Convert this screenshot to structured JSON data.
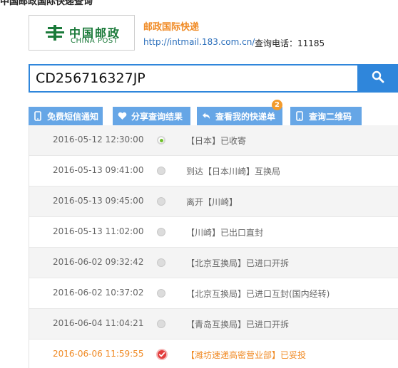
{
  "page": {
    "title": "中国邮政国际快递查询"
  },
  "brand": {
    "logo_cn": "中国邮政",
    "logo_en": "CHINA POST",
    "name": "邮政国际快递",
    "url": "http://intmail.183.com.cn/",
    "phone_label": "查询电话：11185"
  },
  "search": {
    "value": "CD256716327JP"
  },
  "actions": [
    {
      "label": "免费短信通知",
      "icon": "phone-icon"
    },
    {
      "label": "分享查询结果",
      "icon": "heart-icon"
    },
    {
      "label": "查看我的快递单",
      "icon": "back-arrow-icon",
      "badge": "2"
    },
    {
      "label": "查询二维码",
      "icon": "phone-icon"
    }
  ],
  "events": [
    {
      "time": "2016-05-12 12:30:00",
      "desc": "【日本】已收寄",
      "status": "start"
    },
    {
      "time": "2016-05-13 09:41:00",
      "desc": "到达【日本川崎】互换局",
      "status": "normal"
    },
    {
      "time": "2016-05-13 09:45:00",
      "desc": "离开【川崎】",
      "status": "normal"
    },
    {
      "time": "2016-05-13 11:02:00",
      "desc": "【川崎】已出口直封",
      "status": "normal"
    },
    {
      "time": "2016-06-02 09:32:42",
      "desc": "【北京互换局】已进口开拆",
      "status": "normal"
    },
    {
      "time": "2016-06-02 10:37:02",
      "desc": "【北京互换局】已进口互封(国内经转)",
      "status": "normal"
    },
    {
      "time": "2016-06-04 11:04:21",
      "desc": "【青岛互换局】已进口开拆",
      "status": "normal"
    },
    {
      "time": "2016-06-06 11:59:55",
      "desc": "【潍坊速递高密营业部】已妥投",
      "status": "delivered"
    }
  ],
  "colors": {
    "accent": "#2f86db",
    "action": "#66a6e6",
    "highlight": "#f08a24",
    "delivered": "#e23c3c",
    "start": "#6fc02b"
  }
}
